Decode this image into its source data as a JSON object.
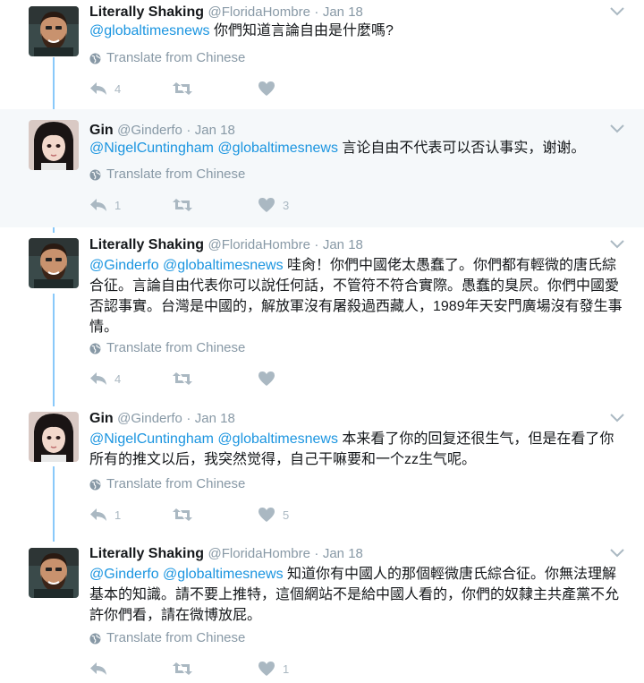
{
  "translate_label": "Translate from Chinese",
  "tweets": [
    {
      "name": "Literally Shaking",
      "handle": "@FloridaHombre",
      "sep": "·",
      "date": "Jan 18",
      "mentions": "@globaltimesnews",
      "body": "你們知道言論自由是什麼嗎?",
      "reply_count": "4",
      "retweet_count": "",
      "like_count": ""
    },
    {
      "name": "Gin",
      "handle": "@Ginderfo",
      "sep": "·",
      "date": "Jan 18",
      "mentions": "@NigelCuntingham @globaltimesnews",
      "body": "言论自由不代表可以否认事实，谢谢。",
      "reply_count": "1",
      "retweet_count": "",
      "like_count": "3"
    },
    {
      "name": "Literally Shaking",
      "handle": "@FloridaHombre",
      "sep": "·",
      "date": "Jan 18",
      "mentions": "@Ginderfo @globaltimesnews",
      "body": "哇肏！你們中國佬太愚蠢了。你們都有輕微的唐氏綜合征。言論自由代表你可以說任何話，不管符不符合實際。愚蠢的臭屄。你們中國愛否認事實。台灣是中國的，解放軍沒有屠殺過西藏人，1989年天安門廣場沒有發生事情。",
      "reply_count": "4",
      "retweet_count": "",
      "like_count": ""
    },
    {
      "name": "Gin",
      "handle": "@Ginderfo",
      "sep": "·",
      "date": "Jan 18",
      "mentions": "@NigelCuntingham @globaltimesnews",
      "body": "本来看了你的回复还很生气，但是在看了你所有的推文以后，我突然觉得，自己干嘛要和一个zz生气呢。",
      "reply_count": "1",
      "retweet_count": "",
      "like_count": "5"
    },
    {
      "name": "Literally Shaking",
      "handle": "@FloridaHombre",
      "sep": "·",
      "date": "Jan 18",
      "mentions": "@Ginderfo @globaltimesnews",
      "body": "知道你有中國人的那個輕微唐氏綜合征。你無法理解基本的知識。請不要上推特，這個網站不是給中國人看的，你們的奴隸主共產黨不允許你們看，請在微博放屁。",
      "reply_count": "",
      "retweet_count": "",
      "like_count": "1"
    }
  ],
  "colors": {
    "link": "#1b95e0",
    "meta": "#8899a6",
    "icon": "#aab8c2",
    "thread_line": "#89c9fa",
    "highlight_bg": "#f5f8fa"
  }
}
